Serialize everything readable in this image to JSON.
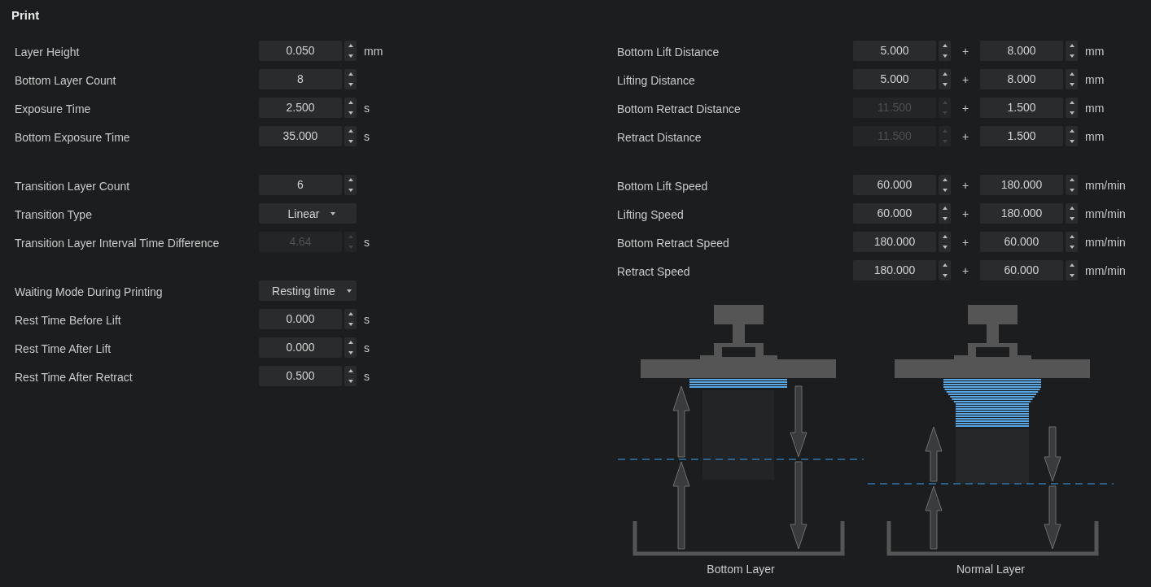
{
  "title": "Print",
  "left_groups": [
    {
      "rows": [
        {
          "label": "Layer Height",
          "kind": "spin",
          "value": "0.050",
          "unit": "mm",
          "disabled": false
        },
        {
          "label": "Bottom Layer Count",
          "kind": "spin",
          "value": "8",
          "disabled": false
        },
        {
          "label": "Exposure Time",
          "kind": "spin",
          "value": "2.500",
          "unit": "s",
          "disabled": false
        },
        {
          "label": "Bottom Exposure Time",
          "kind": "spin",
          "value": "35.000",
          "unit": "s",
          "disabled": false
        }
      ]
    },
    {
      "rows": [
        {
          "label": "Transition Layer Count",
          "kind": "spin",
          "value": "6",
          "disabled": false
        },
        {
          "label": "Transition Type",
          "kind": "select",
          "value": "Linear",
          "disabled": false
        },
        {
          "label": "Transition Layer Interval Time Difference",
          "kind": "spin",
          "value": "4.64",
          "unit": "s",
          "disabled": true
        }
      ]
    },
    {
      "rows": [
        {
          "label": "Waiting Mode During Printing",
          "kind": "select",
          "value": "Resting time",
          "disabled": false
        },
        {
          "label": "Rest Time Before Lift",
          "kind": "spin",
          "value": "0.000",
          "unit": "s",
          "disabled": false
        },
        {
          "label": "Rest Time After Lift",
          "kind": "spin",
          "value": "0.000",
          "unit": "s",
          "disabled": false
        },
        {
          "label": "Rest Time After Retract",
          "kind": "spin",
          "value": "0.500",
          "unit": "s",
          "disabled": false
        }
      ]
    }
  ],
  "right_groups": [
    {
      "rows": [
        {
          "label": "Bottom Lift Distance",
          "first": {
            "value": "5.000",
            "disabled": false
          },
          "plus": "+",
          "second": {
            "value": "8.000",
            "disabled": false
          },
          "unit": "mm"
        },
        {
          "label": "Lifting Distance",
          "first": {
            "value": "5.000",
            "disabled": false
          },
          "plus": "+",
          "second": {
            "value": "8.000",
            "disabled": false
          },
          "unit": "mm"
        },
        {
          "label": "Bottom Retract Distance",
          "first": {
            "value": "11.500",
            "disabled": true
          },
          "plus": "+",
          "second": {
            "value": "1.500",
            "disabled": false
          },
          "unit": "mm"
        },
        {
          "label": "Retract Distance",
          "first": {
            "value": "11.500",
            "disabled": true
          },
          "plus": "+",
          "second": {
            "value": "1.500",
            "disabled": false
          },
          "unit": "mm"
        }
      ]
    },
    {
      "rows": [
        {
          "label": "Bottom Lift Speed",
          "first": {
            "value": "60.000",
            "disabled": false
          },
          "plus": "+",
          "second": {
            "value": "180.000",
            "disabled": false
          },
          "unit": "mm/min"
        },
        {
          "label": "Lifting Speed",
          "first": {
            "value": "60.000",
            "disabled": false
          },
          "plus": "+",
          "second": {
            "value": "180.000",
            "disabled": false
          },
          "unit": "mm/min"
        },
        {
          "label": "Bottom Retract Speed",
          "first": {
            "value": "180.000",
            "disabled": false
          },
          "plus": "+",
          "second": {
            "value": "60.000",
            "disabled": false
          },
          "unit": "mm/min"
        },
        {
          "label": "Retract Speed",
          "first": {
            "value": "180.000",
            "disabled": false
          },
          "plus": "+",
          "second": {
            "value": "60.000",
            "disabled": false
          },
          "unit": "mm/min"
        }
      ]
    }
  ],
  "diagrams": [
    {
      "kind": "bottom",
      "caption": "Bottom Layer"
    },
    {
      "kind": "normal",
      "caption": "Normal Layer"
    }
  ]
}
